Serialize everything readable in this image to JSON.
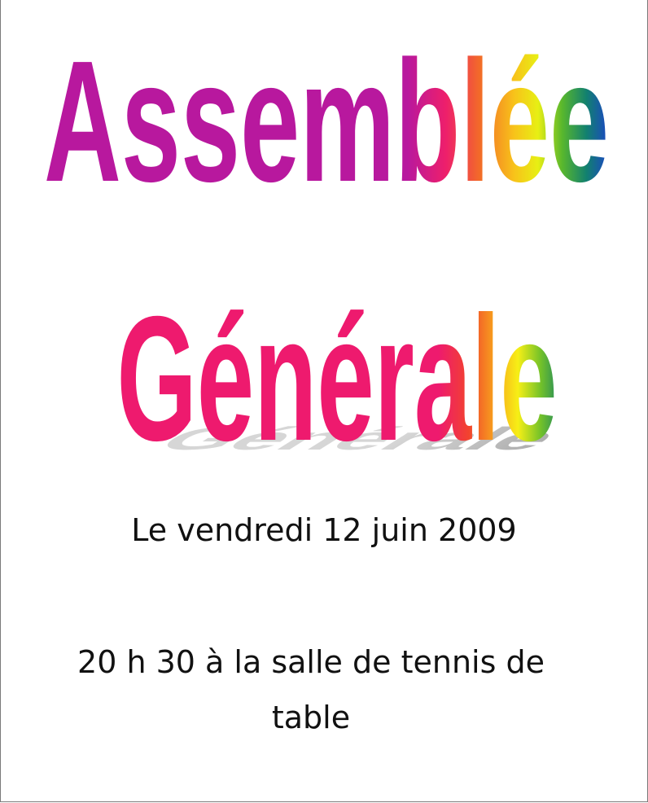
{
  "title": {
    "line1": "Assemblée",
    "line2": "Générale"
  },
  "date_text": "Le vendredi 12 juin 2009",
  "location_line1": "20 h 30 à la salle de tennis de",
  "location_line2": "table",
  "colors": {
    "rainbow": [
      "#c4169c",
      "#ef2457",
      "#f7a21c",
      "#f7ef14",
      "#5fbf2c",
      "#138a6c",
      "#1d3fd8",
      "#7b1ed0"
    ],
    "shadow": "#a9a9a9",
    "text": "#111111",
    "border": "#7a7a7a"
  }
}
